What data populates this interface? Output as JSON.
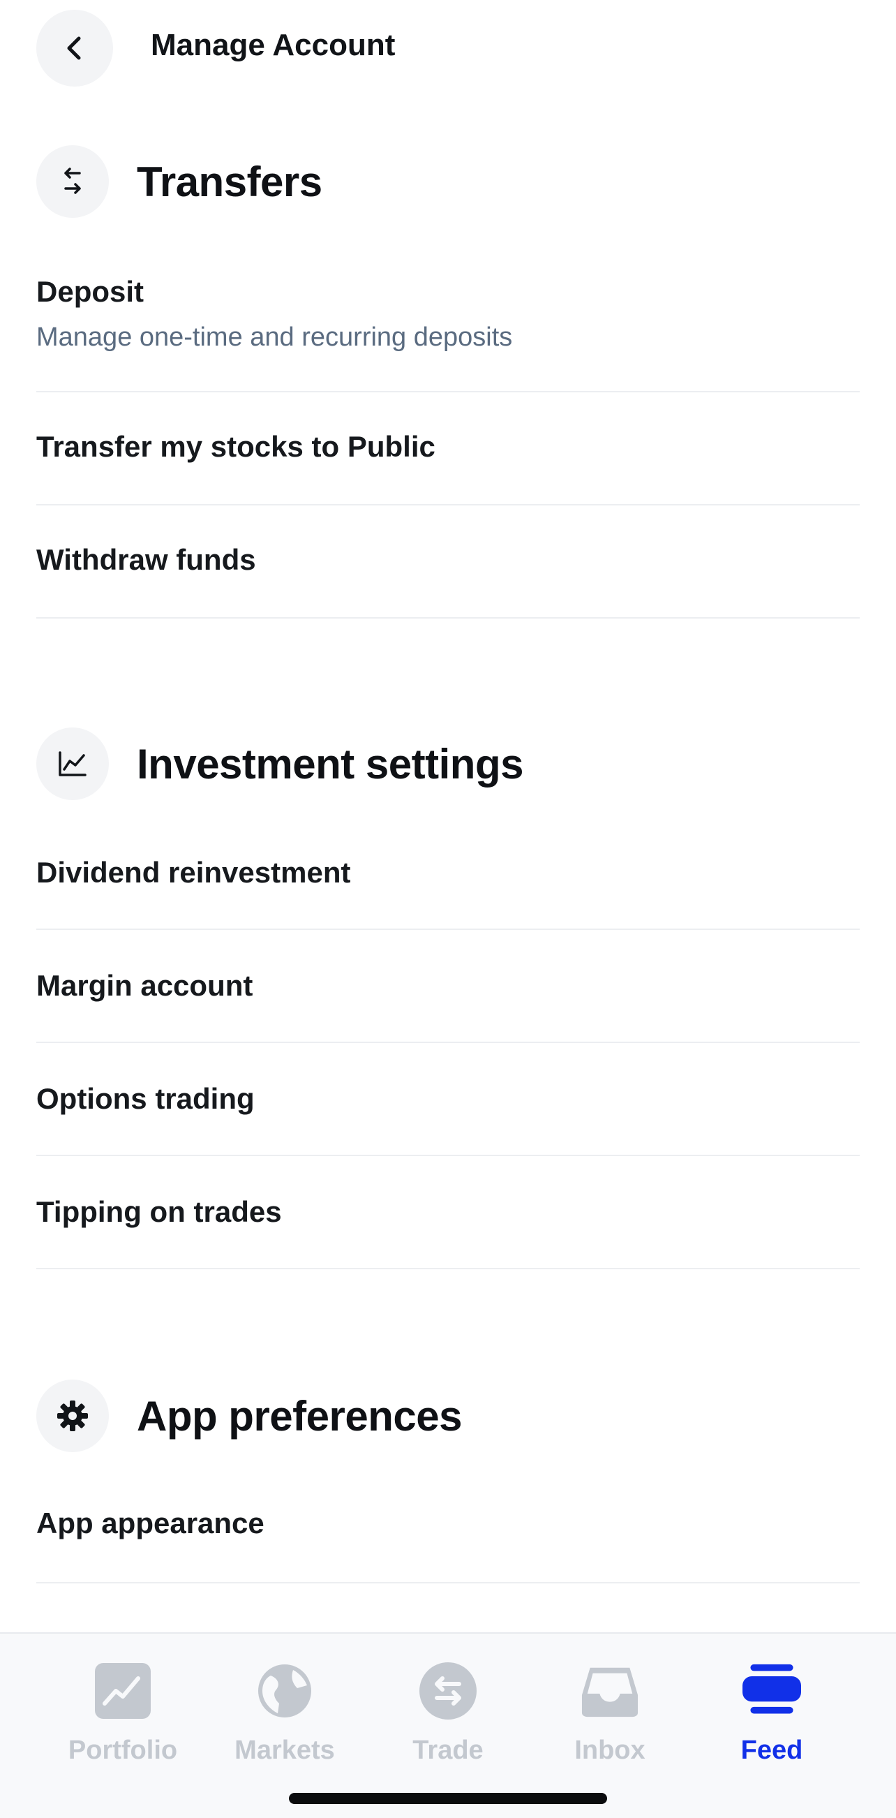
{
  "header": {
    "title": "Manage Account"
  },
  "sections": {
    "transfers": {
      "title": "Transfers",
      "icon": "arrows-swap-icon",
      "items": [
        {
          "label": "Deposit",
          "sub": "Manage one-time and recurring deposits"
        },
        {
          "label": "Transfer my stocks to Public"
        },
        {
          "label": "Withdraw funds"
        }
      ]
    },
    "investment": {
      "title": "Investment settings",
      "icon": "line-chart-icon",
      "items": [
        {
          "label": "Dividend reinvestment"
        },
        {
          "label": "Margin account"
        },
        {
          "label": "Options trading"
        },
        {
          "label": "Tipping on trades"
        }
      ]
    },
    "preferences": {
      "title": "App preferences",
      "icon": "gear-icon",
      "items": [
        {
          "label": "App appearance"
        }
      ]
    }
  },
  "tabbar": {
    "tabs": [
      {
        "label": "Portfolio",
        "icon": "chart-square-icon",
        "active": false
      },
      {
        "label": "Markets",
        "icon": "globe-icon",
        "active": false
      },
      {
        "label": "Trade",
        "icon": "swap-circle-icon",
        "active": false
      },
      {
        "label": "Inbox",
        "icon": "inbox-icon",
        "active": false
      },
      {
        "label": "Feed",
        "icon": "feed-icon",
        "active": true
      }
    ]
  },
  "colors": {
    "accent": "#1130e8",
    "inactive": "#c3c8cf",
    "subtitle": "#5a6b80"
  }
}
